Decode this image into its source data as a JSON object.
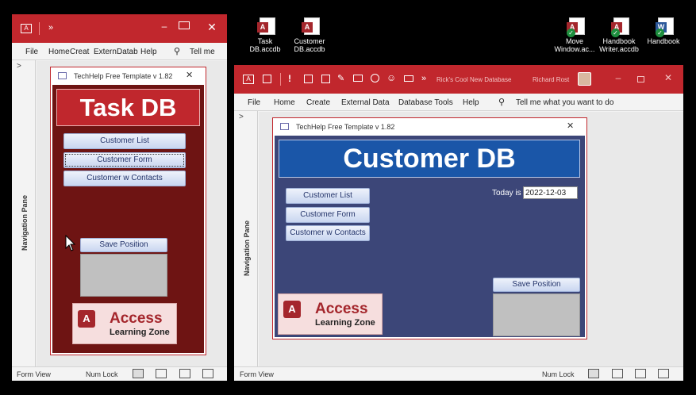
{
  "desktop": {
    "icons": [
      {
        "label": "Task DB.accdb",
        "type": "access"
      },
      {
        "label": "Customer DB.accdb",
        "type": "access"
      },
      {
        "label": "Move Window.ac...",
        "type": "access-check"
      },
      {
        "label": "Handbook Writer.accdb",
        "type": "access-check"
      },
      {
        "label": "Handbook",
        "type": "word-check"
      }
    ]
  },
  "left_window": {
    "menu_more": "»",
    "ribbon_tabs": [
      "File",
      "Home",
      "Creat",
      "Extern",
      "Datab",
      "Help"
    ],
    "tell_me": "Tell me",
    "nav_pane_label": "Navigation Pane",
    "form_title": "TechHelp Free Template v 1.82",
    "header": "Task DB",
    "buttons": {
      "customer_list": "Customer List",
      "customer_form": "Customer Form",
      "customer_w_contacts": "Customer w Contacts",
      "save_position": "Save Position"
    },
    "logo": {
      "line1": "Access",
      "line2": "Learning Zone",
      "letter": "A"
    },
    "status": {
      "left": "Form View",
      "num_lock": "Num Lock"
    }
  },
  "right_window": {
    "menu_more": "»",
    "title": "Rick's Cool New Database",
    "user": "Richard Rost",
    "ribbon_tabs": [
      "File",
      "Home",
      "Create",
      "External Data",
      "Database Tools",
      "Help"
    ],
    "tell_me": "Tell me what you want to do",
    "nav_pane_label": "Navigation Pane",
    "form_title": "TechHelp Free Template v 1.82",
    "header": "Customer DB",
    "today_label": "Today is",
    "today_value": "2022-12-03",
    "buttons": {
      "customer_list": "Customer List",
      "customer_form": "Customer Form",
      "customer_w_contacts": "Customer w Contacts",
      "save_position": "Save Position"
    },
    "logo": {
      "line1": "Access",
      "line2": "Learning Zone",
      "letter": "A"
    },
    "status": {
      "left": "Form View",
      "num_lock": "Num Lock"
    }
  },
  "colors": {
    "title_red": "#c1272d",
    "task_form_bg": "#6e1413",
    "customer_form_bg": "#3c4678",
    "customer_header_bg": "#1a56a8"
  }
}
